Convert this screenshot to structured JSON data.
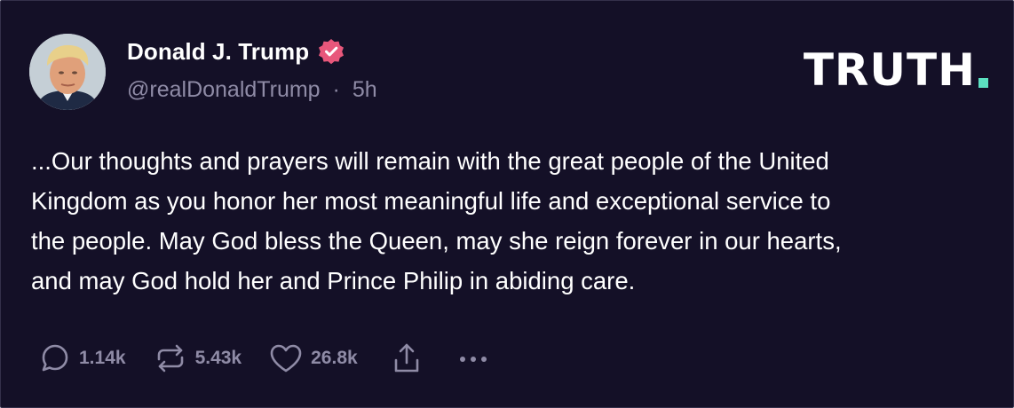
{
  "colors": {
    "background": "#141027",
    "text": "#ffffff",
    "muted": "#8f8ba6",
    "verified_badge": "#e8577b",
    "logo_accent": "#5ce1c1"
  },
  "post": {
    "display_name": "Donald J. Trump",
    "handle": "@realDonaldTrump",
    "separator": "·",
    "time": "5h",
    "verified_icon": "verified-badge-icon",
    "lines": [
      "...Our thoughts and prayers will remain with the great people of the United",
      "Kingdom as you honor her most meaningful life and exceptional service to",
      "the people. May God bless the Queen, may she reign forever in our hearts,",
      "and may God hold her and Prince Philip in abiding care."
    ]
  },
  "brand": {
    "logo_text": "TRUTH"
  },
  "actions": {
    "reply": {
      "icon": "reply-icon",
      "count": "1.14k"
    },
    "retruth": {
      "icon": "retruth-icon",
      "count": "5.43k"
    },
    "like": {
      "icon": "heart-icon",
      "count": "26.8k"
    },
    "share": {
      "icon": "share-icon"
    },
    "more": {
      "icon": "more-icon"
    }
  }
}
